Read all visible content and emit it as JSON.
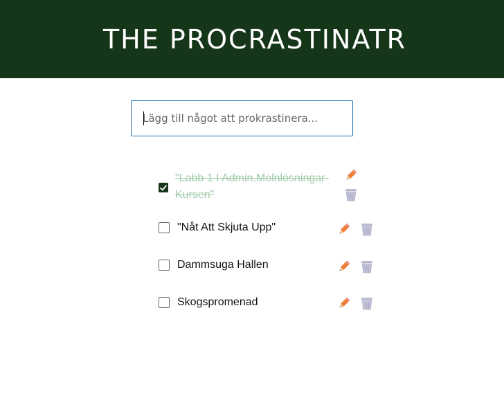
{
  "header": {
    "title": "THE PROCRASTINATR"
  },
  "new_todo": {
    "placeholder": "Lägg till något att prokrastinera...",
    "value": ""
  },
  "todos": [
    {
      "label": "\"Labb 1 I Admin.Molnlösningar-Kursen\"",
      "done": true,
      "line1": "\"Labb 1 I Admin.Molnlösningar-",
      "line2": "Kursen\""
    },
    {
      "label": "\"Nåt Att Skjuta Upp\"",
      "done": false
    },
    {
      "label": "Dammsuga Hallen",
      "done": false
    },
    {
      "label": "Skogspromenad",
      "done": false
    }
  ],
  "colors": {
    "header_bg": "#16361a",
    "input_border": "#1f6fb4",
    "done_text": "#9fc9a6",
    "pencil": "#f07c3a",
    "trash": "#b9b9d2"
  },
  "icons": {
    "edit": "pencil-icon",
    "delete": "trash-icon"
  }
}
